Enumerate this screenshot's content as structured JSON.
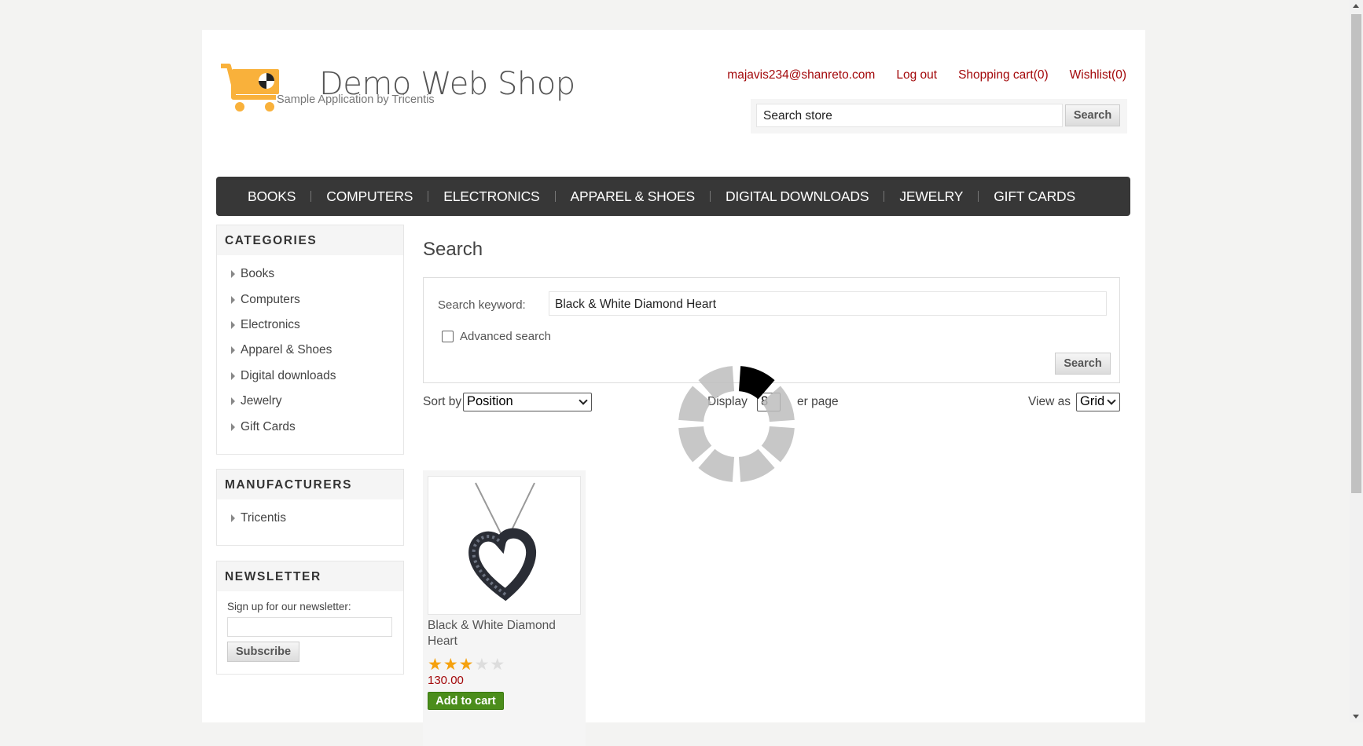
{
  "header": {
    "logo_title": "Demo Web Shop",
    "logo_subtitle": "Sample Application by Tricentis",
    "links": [
      "majavis234@shanreto.com",
      "Log out",
      "Shopping cart(0)",
      "Wishlist(0)"
    ],
    "search_placeholder": "Search store",
    "search_button": "Search"
  },
  "topmenu": [
    "BOOKS",
    "COMPUTERS",
    "ELECTRONICS",
    "APPAREL & SHOES",
    "DIGITAL DOWNLOADS",
    "JEWELRY",
    "GIFT CARDS"
  ],
  "sidebar": {
    "categories_title": "CATEGORIES",
    "categories": [
      "Books",
      "Computers",
      "Electronics",
      "Apparel & Shoes",
      "Digital downloads",
      "Jewelry",
      "Gift Cards"
    ],
    "manufacturers_title": "MANUFACTURERS",
    "manufacturers": [
      "Tricentis"
    ],
    "newsletter_title": "NEWSLETTER",
    "newsletter_label": "Sign up for our newsletter:",
    "newsletter_button": "Subscribe"
  },
  "main": {
    "title": "Search",
    "keyword_label": "Search keyword:",
    "keyword_value": "Black & White Diamond Heart",
    "advanced_label": "Advanced search",
    "search_button": "Search",
    "sort_label": "Sort by",
    "sort_value": "Position",
    "display_label": "Display",
    "display_value": "8",
    "per_page_label": "er page",
    "view_label": "View as",
    "view_value": "Grid"
  },
  "product": {
    "title": "Black & White Diamond Heart",
    "rating": 3,
    "rating_max": 5,
    "price": "130.00",
    "add_button": "Add to cart"
  },
  "colors": {
    "link_red": "#a3080a",
    "menu_bg": "#373737",
    "add_green": "#4b8d1b",
    "star": "#f5a10e",
    "logo_orange": "#f9b13b"
  }
}
